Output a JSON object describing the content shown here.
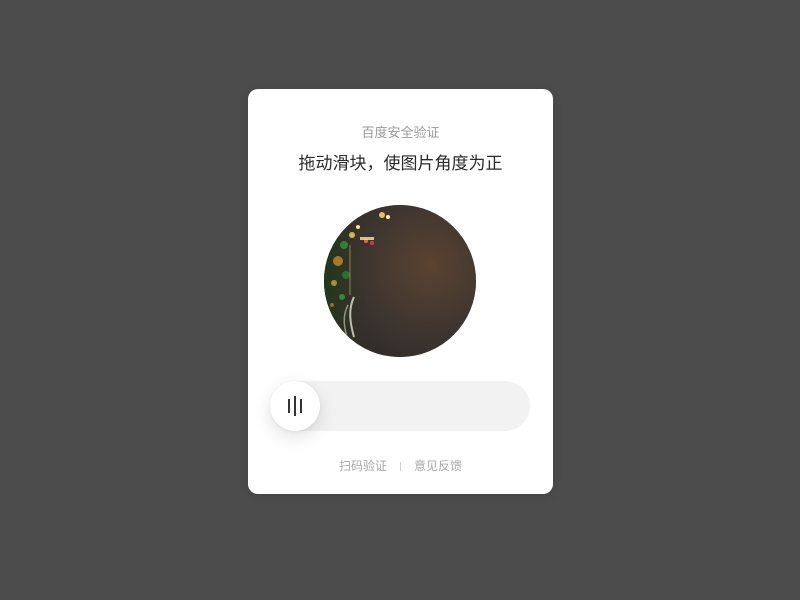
{
  "captcha": {
    "brand_title": "百度安全验证",
    "instruction": "拖动滑块，使图片角度为正",
    "image_description_icon": "rotated-night-city-photo",
    "slider": {
      "knob_icon": "drag-handle-bars-icon",
      "position": 0
    },
    "footer": {
      "scan_label": "扫码验证",
      "feedback_label": "意见反馈"
    }
  },
  "colors": {
    "backdrop": "#4c4c4c",
    "card": "#ffffff",
    "track": "#f2f2f2",
    "muted_text": "#9a9a9a",
    "title_text": "#2a2a2a"
  }
}
